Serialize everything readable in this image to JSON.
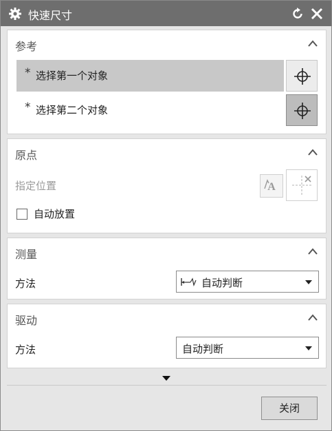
{
  "dialog": {
    "title": "快速尺寸",
    "icons": {
      "app": "gear-icon",
      "reset": "reset-icon",
      "close": "close-icon"
    }
  },
  "reference": {
    "title": "参考",
    "rows": [
      {
        "marker": "*",
        "label": "选择第一个对象",
        "active": true
      },
      {
        "marker": "*",
        "label": "选择第二个对象",
        "active": false
      }
    ],
    "pick_icon": "crosshair-icon"
  },
  "origin": {
    "title": "原点",
    "specify_position_label": "指定位置",
    "auto_place_label": "自动放置",
    "auto_place_checked": false,
    "icons": [
      "text-origin-icon",
      "point-dialog-icon"
    ]
  },
  "measure": {
    "title": "测量",
    "method_label": "方法",
    "method_value": "自动判断",
    "method_icon": "dimension-icon"
  },
  "drive": {
    "title": "驱动",
    "method_label": "方法",
    "method_value": "自动判断"
  },
  "footer": {
    "more_icon": "expand-more-icon",
    "close_label": "关闭"
  },
  "colors": {
    "titlebar": "#6e6e6e",
    "panel": "#ffffff",
    "background": "#e6e6e6",
    "active_row": "#c8c8c8"
  }
}
